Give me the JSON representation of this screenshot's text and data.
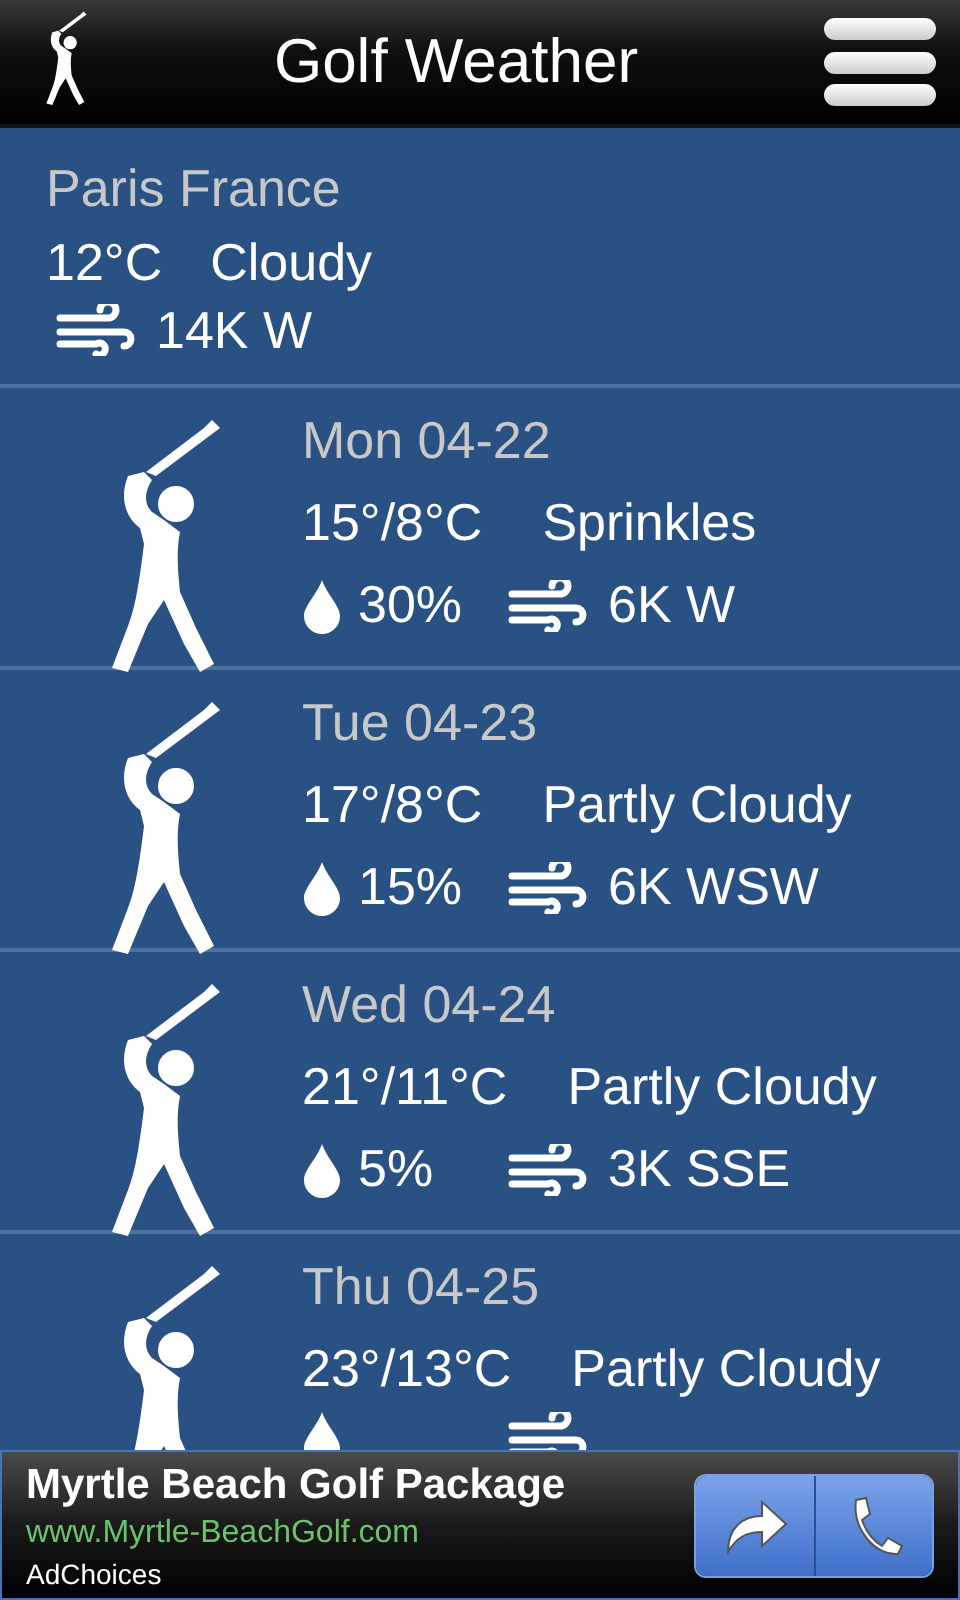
{
  "header": {
    "title": "Golf Weather"
  },
  "current": {
    "location": "Paris France",
    "temperature": "12°C",
    "condition": "Cloudy",
    "wind": "14K W"
  },
  "forecast": [
    {
      "date": "Mon 04-22",
      "temperature": "15°/8°C",
      "condition": "Sprinkles",
      "rain": "30%",
      "wind": "6K W"
    },
    {
      "date": "Tue 04-23",
      "temperature": "17°/8°C",
      "condition": "Partly Cloudy",
      "rain": "15%",
      "wind": "6K WSW"
    },
    {
      "date": "Wed 04-24",
      "temperature": "21°/11°C",
      "condition": "Partly Cloudy",
      "rain": "5%",
      "wind": "3K SSE"
    },
    {
      "date": "Thu 04-25",
      "temperature": "23°/13°C",
      "condition": "Partly Cloudy"
    }
  ],
  "ad": {
    "title": "Myrtle Beach Golf Package",
    "url": "www.Myrtle-BeachGolf.com",
    "label": "AdChoices"
  }
}
